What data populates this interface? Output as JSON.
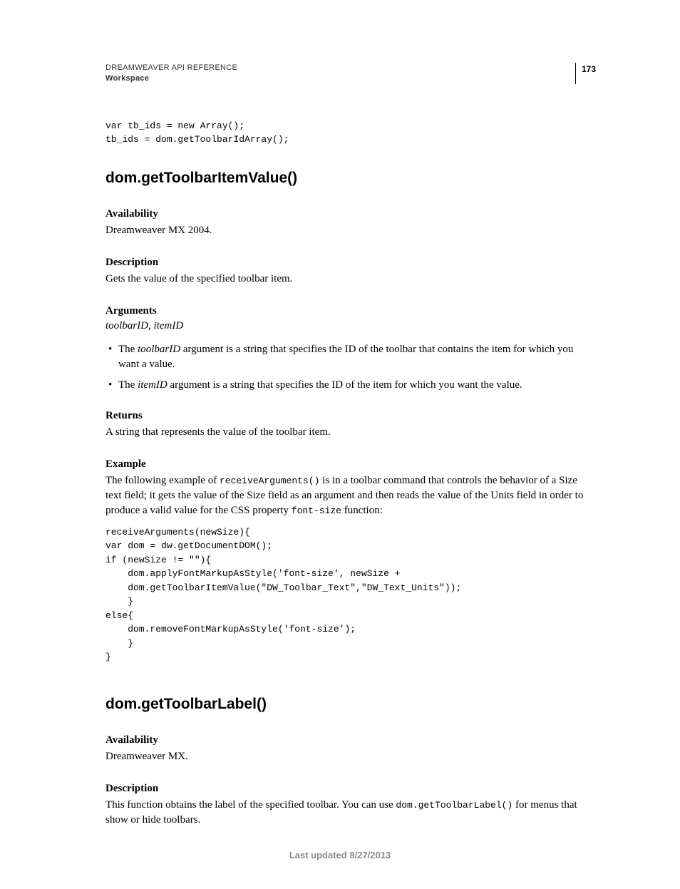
{
  "header": {
    "doc_title": "DREAMWEAVER API REFERENCE",
    "chapter": "Workspace",
    "page_number": "173"
  },
  "code_top": "var tb_ids = new Array();\ntb_ids = dom.getToolbarIdArray();",
  "fn1": {
    "title": "dom.getToolbarItemValue()",
    "avail_label": "Availability",
    "avail_text": "Dreamweaver MX 2004.",
    "desc_label": "Description",
    "desc_text": "Gets the value of the specified toolbar item.",
    "args_label": "Arguments",
    "args_sig": "toolbarID, itemID",
    "bullet1_pre": "The ",
    "bullet1_em": "toolbarID",
    "bullet1_post": " argument is a string that specifies the ID of the toolbar that contains the item for which you want a value.",
    "bullet2_pre": "The ",
    "bullet2_em": "itemID",
    "bullet2_post": " argument is a string that specifies the ID of the item for which you want the value.",
    "returns_label": "Returns",
    "returns_text": "A string that represents the value of the toolbar item.",
    "example_label": "Example",
    "example_p1": "The following example of ",
    "example_code1": "receiveArguments()",
    "example_p2": " is in a toolbar command that controls the behavior of a Size text field; it gets the value of the Size field as an argument and then reads the value of the Units field in order to produce a valid value for the CSS property ",
    "example_code2": "font-size",
    "example_p3": " function:",
    "example_block": "receiveArguments(newSize){ \nvar dom = dw.getDocumentDOM();\nif (newSize != \"\"){ \n    dom.applyFontMarkupAsStyle('font-size', newSize + \n    dom.getToolbarItemValue(\"DW_Toolbar_Text\",\"DW_Text_Units\")); \n    } \nelse{ \n    dom.removeFontMarkupAsStyle('font-size'); \n    } \n}"
  },
  "fn2": {
    "title": "dom.getToolbarLabel()",
    "avail_label": "Availability",
    "avail_text": "Dreamweaver MX.",
    "desc_label": "Description",
    "desc_p1": "This function obtains the label of the specified toolbar. You can use ",
    "desc_code": "dom.getToolbarLabel()",
    "desc_p2": " for menus that show or hide toolbars."
  },
  "footer": "Last updated 8/27/2013"
}
